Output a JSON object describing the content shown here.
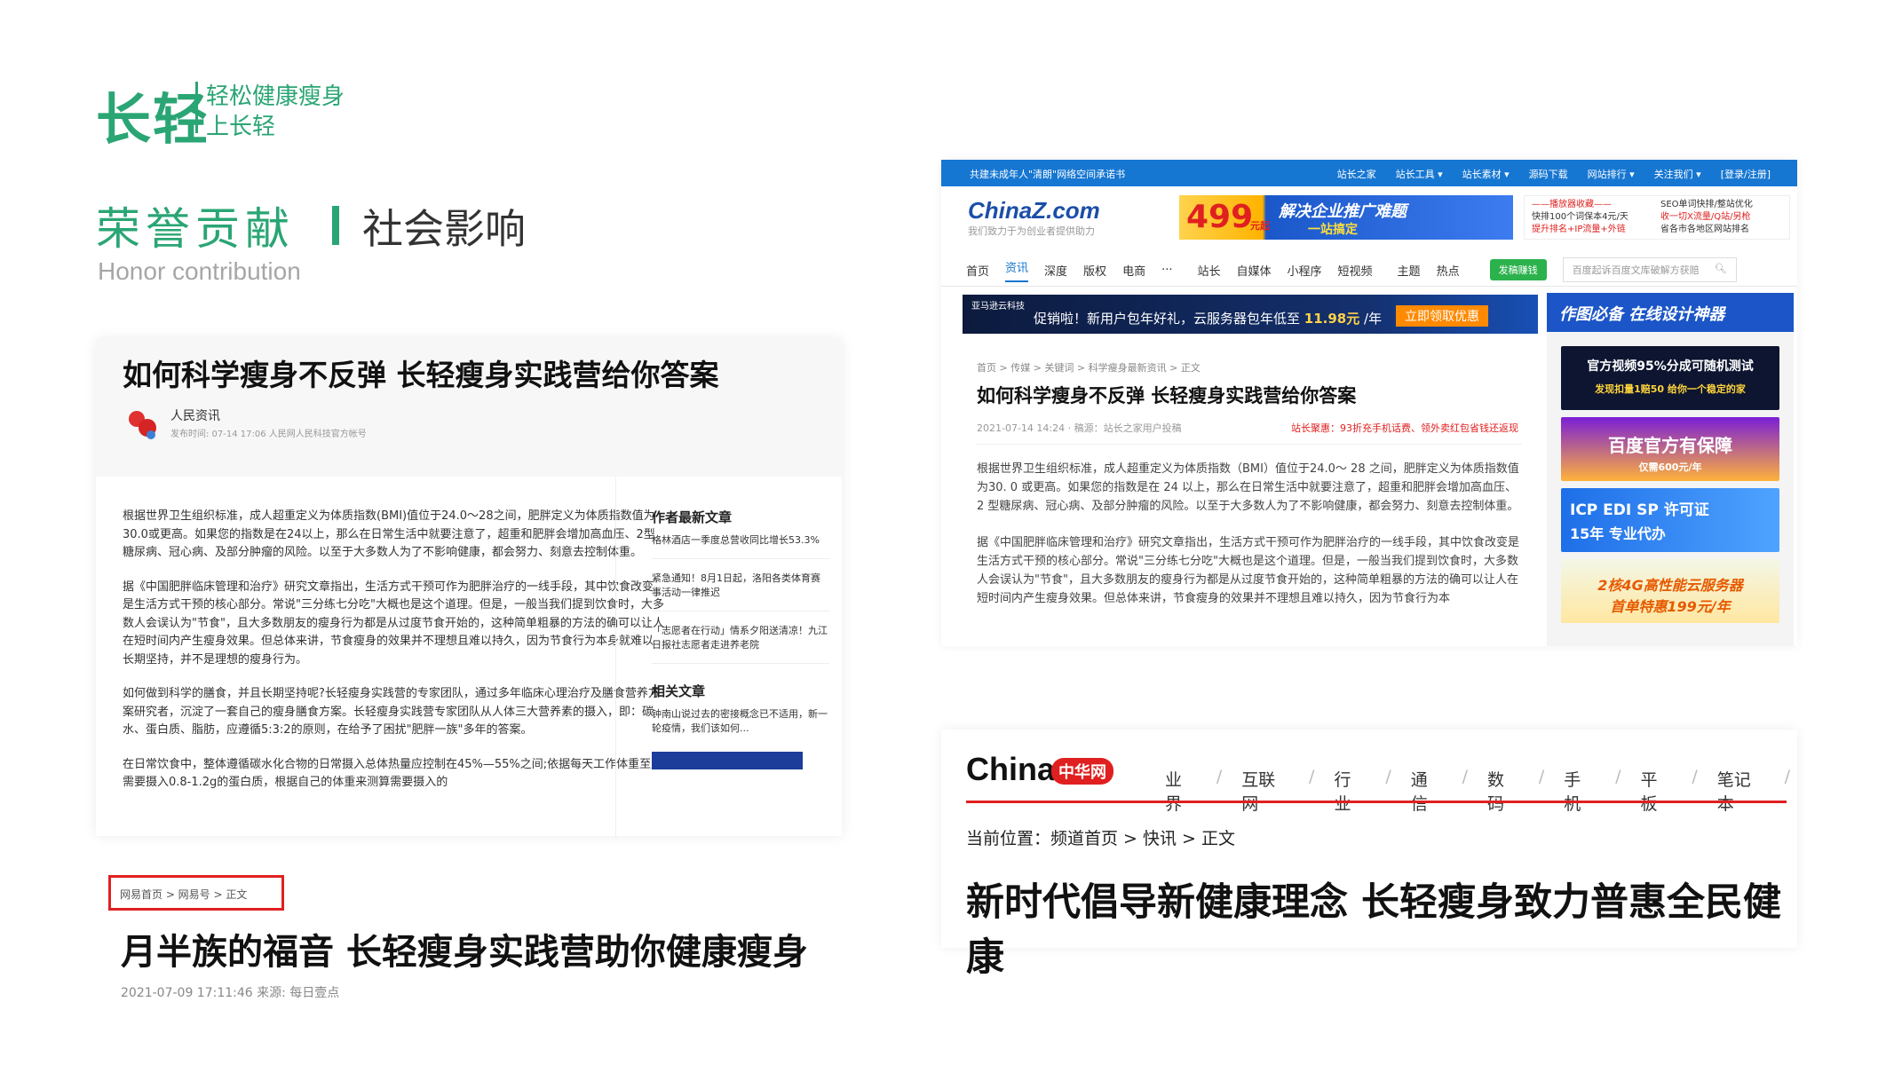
{
  "header": {
    "logo": "长轻",
    "logo_slogan_1": "轻松健康瘦身",
    "logo_slogan_2": "上长轻",
    "title": "荣誉贡献",
    "subtitle": "社会影响",
    "title_en": "Honor contribution"
  },
  "card1": {
    "title": "如何科学瘦身不反弹 长轻瘦身实践营给你答案",
    "source": "人民资讯",
    "time": "发布时间: 07-14  17:06    人民网人民科技官方帐号",
    "paragraphs": [
      "根据世界卫生组织标准，成人超重定义为体质指数(BMI)值位于24.0～28之间，肥胖定义为体质指数值为30.0或更高。如果您的指数是在24以上，那么在日常生活中就要注意了，超重和肥胖会增加高血压、2型糖尿病、冠心病、及部分肿瘤的风险。以至于大多数人为了不影响健康，都会努力、刻意去控制体重。",
      "据《中国肥胖临床管理和治疗》研究文章指出，生活方式干预可作为肥胖治疗的一线手段，其中饮食改变是生活方式干预的核心部分。常说\"三分练七分吃\"大概也是这个道理。但是，一般当我们提到饮食时，大多数人会误认为\"节食\"，且大多数朋友的瘦身行为都是从过度节食开始的，这种简单粗暴的方法的确可以让人在短时间内产生瘦身效果。但总体来讲，节食瘦身的效果并不理想且难以持久，因为节食行为本身就难以长期坚持，并不是理想的瘦身行为。",
      "如何做到科学的膳食，并且长期坚持呢?长轻瘦身实践营的专家团队，通过多年临床心理治疗及膳食营养方案研究者，沉淀了一套自己的瘦身膳食方案。长轻瘦身实践营专家团队从人体三大营养素的摄入，即：碳水、蛋白质、脂肪，应遵循5:3:2的原则，在给予了困扰\"肥胖一族\"多年的答案。",
      "在日常饮食中，整体遵循碳水化合物的日常摄入总体热量应控制在45%—55%之间;依据每天工作体重至少需要摄入0.8-1.2g的蛋白质，根据自己的体重来测算需要摄入的"
    ],
    "side_h1": "作者最新文章",
    "side_items": [
      "格林酒店一季度总营收同比增长53.3%",
      "紧急通知！8月1日起，洛阳各类体育赛事活动一律推迟",
      "「志愿者在行动」情系夕阳送清凉！九江日报社志愿者走进养老院"
    ],
    "side_h2": "相关文章",
    "side_related": "钟南山说过去的密接概念已不适用，新一轮疫情，我们该如何..."
  },
  "netease": {
    "breadcrumb": "网易首页 > 网易号 > 正文",
    "title": "月半族的福音 长轻瘦身实践营助你健康瘦身",
    "time": "2021-07-09 17:11:46   来源: 每日壹点"
  },
  "chinaz": {
    "topbar_left": "共建未成年人\"清朗\"网络空间承诺书",
    "topbar_links": [
      "站长之家",
      "站长工具 ▾",
      "站长素材 ▾",
      "源码下载",
      "网站排行 ▾",
      "关注我们 ▾",
      "[登录/注册]"
    ],
    "logo": "ChinaZ.com",
    "slogan": "我们致力于为创业者提供助力",
    "banner_price": "499",
    "banner_unit": "元起",
    "banner_text": "解决企业推广难题",
    "banner_text2": "一站搞定",
    "ad_right": [
      "——播放器收藏——",
      "SEO单词快排/整站优化",
      "快排100个词保本4元/天",
      "收一切X流量/Q站/另枪",
      "提升排名+IP流量+外链",
      "省各市各地区网站排名"
    ],
    "nav": [
      "首页",
      "资讯",
      "深度",
      "版权",
      "电商",
      "···",
      "站长",
      "自媒体",
      "小程序",
      "短视频",
      "主题",
      "热点"
    ],
    "nav_button": "发稿赚钱",
    "search_placeholder": "百度起诉百度文库破解方获赔",
    "banner2_brand": "亚马逊云科技",
    "banner2_text": "促销啦！新用户包年好礼，云服务器包年低至",
    "banner2_price": "11.98元",
    "banner2_unit": "/年",
    "banner2_btn": "立即领取优惠",
    "breadcrumb": "首页 > 传媒 > 关键词 > 科学瘦身最新资讯 > 正文",
    "title": "如何科学瘦身不反弹 长轻瘦身实践营给你答案",
    "meta": "2021-07-14 14:24  ·  稿源：站长之家用户投稿",
    "meta_hot": "站长聚惠：93折充手机话费、领外卖红包省钱还返现",
    "paragraphs": [
      "根据世界卫生组织标准，成人超重定义为体质指数（BMI）值位于24.0～ 28 之间，肥胖定义为体质指数值为30. 0 或更高。如果您的指数是在 24 以上，那么在日常生活中就要注意了，超重和肥胖会增加高血压、 2 型糖尿病、冠心病、及部分肿瘤的风险。以至于大多数人为了不影响健康，都会努力、刻意去控制体重。",
      "据《中国肥胖临床管理和治疗》研究文章指出，生活方式干预可作为肥胖治疗的一线手段，其中饮食改变是生活方式干预的核心部分。常说\"三分练七分吃\"大概也是这个道理。但是，一般当我们提到饮食时，大多数人会误认为\"节食\"，且大多数朋友的瘦身行为都是从过度节食开始的，这种简单粗暴的方法的确可以让人在短时间内产生瘦身效果。但总体来讲，节食瘦身的效果并不理想且难以持久，因为节食行为本"
    ],
    "side_banner": "作图必备  在线设计神器",
    "ads": [
      {
        "l1": "官方视频95%分成可随机测试",
        "l2": "发现扣量1赔50 给你一个稳定的家"
      },
      {
        "l1": "百度官方有保障",
        "l2": "仅需600元/年"
      },
      {
        "l1": "ICP EDI SP 许可证",
        "l2": "15年 专业代办"
      },
      {
        "l1": "2核4G高性能云服务器",
        "l2": "首单特惠199元/年"
      }
    ]
  },
  "chinacom": {
    "logo": "China",
    "logo_red": "中华网",
    "nav": [
      "业界",
      "互联网",
      "行业",
      "通信",
      "数码",
      "手机",
      "平板",
      "笔记本"
    ],
    "breadcrumb": "当前位置：频道首页 > 快讯 > 正文",
    "title": "新时代倡导新健康理念 长轻瘦身致力普惠全民健康"
  },
  "colors": {
    "brand_green": "#2aa574",
    "netease_red": "#e02020",
    "chinaz_blue": "#1677d2"
  }
}
